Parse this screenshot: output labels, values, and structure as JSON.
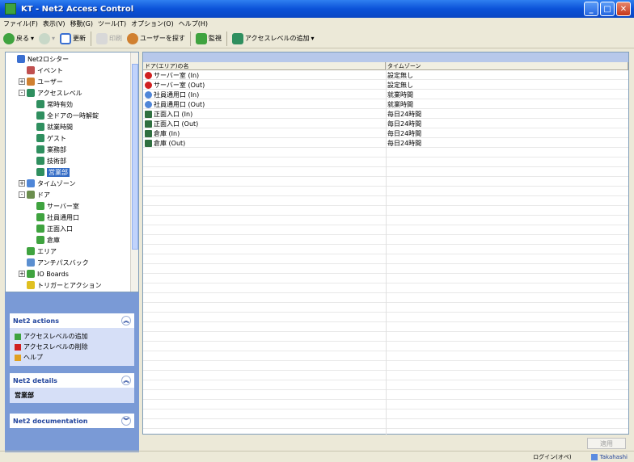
{
  "window": {
    "title": "KT - Net2 Access Control",
    "minimize": "_",
    "maximize": "□",
    "close": "✕"
  },
  "menu": [
    "ファイル(F)",
    "表示(V)",
    "移動(G)",
    "ツール(T)",
    "オプション(O)",
    "ヘルプ(H)"
  ],
  "toolbar": {
    "back": "戻る",
    "refresh": "更新",
    "print": "印刷",
    "user_search": "ユーザーを探す",
    "monitor": "監視",
    "access_level_add": "アクセスレベルの追加"
  },
  "tree": {
    "nodes": [
      {
        "label": "Net2ロシター",
        "indent": 0,
        "icon": "#3a6fd1",
        "exp": ""
      },
      {
        "label": "イベント",
        "indent": 1,
        "icon": "#c05050",
        "exp": ""
      },
      {
        "label": "ユーザー",
        "indent": 1,
        "icon": "#d08030",
        "exp": "+"
      },
      {
        "label": "アクセスレベル",
        "indent": 1,
        "icon": "#2f8f5f",
        "exp": "-"
      },
      {
        "label": "常時有効",
        "indent": 2,
        "icon": "#2f8f5f",
        "exp": ""
      },
      {
        "label": "全ドアの一時解錠",
        "indent": 2,
        "icon": "#2f8f5f",
        "exp": ""
      },
      {
        "label": "就業時間",
        "indent": 2,
        "icon": "#2f8f5f",
        "exp": ""
      },
      {
        "label": "ゲスト",
        "indent": 2,
        "icon": "#2f8f5f",
        "exp": ""
      },
      {
        "label": "業務部",
        "indent": 2,
        "icon": "#2f8f5f",
        "exp": ""
      },
      {
        "label": "技術部",
        "indent": 2,
        "icon": "#2f8f5f",
        "exp": ""
      },
      {
        "label": "営業部",
        "indent": 2,
        "icon": "#2f8f5f",
        "exp": "",
        "selected": true
      },
      {
        "label": "タイムゾーン",
        "indent": 1,
        "icon": "#4f86d8",
        "exp": "+"
      },
      {
        "label": "ドア",
        "indent": 1,
        "icon": "#6b8e4e",
        "exp": "-"
      },
      {
        "label": "サーバー室",
        "indent": 2,
        "icon": "#3fa33f",
        "exp": ""
      },
      {
        "label": "社員通用口",
        "indent": 2,
        "icon": "#3fa33f",
        "exp": ""
      },
      {
        "label": "正面入口",
        "indent": 2,
        "icon": "#3fa33f",
        "exp": ""
      },
      {
        "label": "倉庫",
        "indent": 2,
        "icon": "#3fa33f",
        "exp": ""
      },
      {
        "label": "エリア",
        "indent": 1,
        "icon": "#3fa33f",
        "exp": ""
      },
      {
        "label": "アンチパスバック",
        "indent": 1,
        "icon": "#5b8fd0",
        "exp": ""
      },
      {
        "label": "IO Boards",
        "indent": 1,
        "icon": "#3fa33f",
        "exp": "+"
      },
      {
        "label": "トリガーとアクション",
        "indent": 1,
        "icon": "#e0c020",
        "exp": ""
      }
    ]
  },
  "actions_panel": {
    "title": "Net2 actions",
    "items": [
      {
        "label": "アクセスレベルの追加",
        "icon": "#3fa33f"
      },
      {
        "label": "アクセスレベルの削除",
        "icon": "#d02020"
      },
      {
        "label": "ヘルプ",
        "icon": "#e0a020"
      }
    ]
  },
  "details_panel": {
    "title": "Net2 details",
    "value": "営業部"
  },
  "docs_panel": {
    "title": "Net2 documentation"
  },
  "table": {
    "col1": "ドア(エリア)の名",
    "col2": "タイムゾーン",
    "rows": [
      {
        "door": "サーバー室 (In)",
        "zone": "設定無し",
        "icon": "#d02020",
        "shape": "circle"
      },
      {
        "door": "サーバー室 (Out)",
        "zone": "設定無し",
        "icon": "#d02020",
        "shape": "circle"
      },
      {
        "door": "社員通用口 (In)",
        "zone": "就業時間",
        "icon": "#4f86d8",
        "shape": "circle"
      },
      {
        "door": "社員通用口 (Out)",
        "zone": "就業時間",
        "icon": "#4f86d8",
        "shape": "circle"
      },
      {
        "door": "正面入口 (In)",
        "zone": "毎日24時間",
        "icon": "#2f6f3f",
        "shape": "sq"
      },
      {
        "door": "正面入口 (Out)",
        "zone": "毎日24時間",
        "icon": "#2f6f3f",
        "shape": "sq"
      },
      {
        "door": "倉庫 (In)",
        "zone": "毎日24時間",
        "icon": "#2f6f3f",
        "shape": "sq"
      },
      {
        "door": "倉庫 (Out)",
        "zone": "毎日24時間",
        "icon": "#2f6f3f",
        "shape": "sq"
      }
    ]
  },
  "apply_button": "適用",
  "status": {
    "mode": "ログイン(オペ)",
    "user": "Takahashi"
  }
}
